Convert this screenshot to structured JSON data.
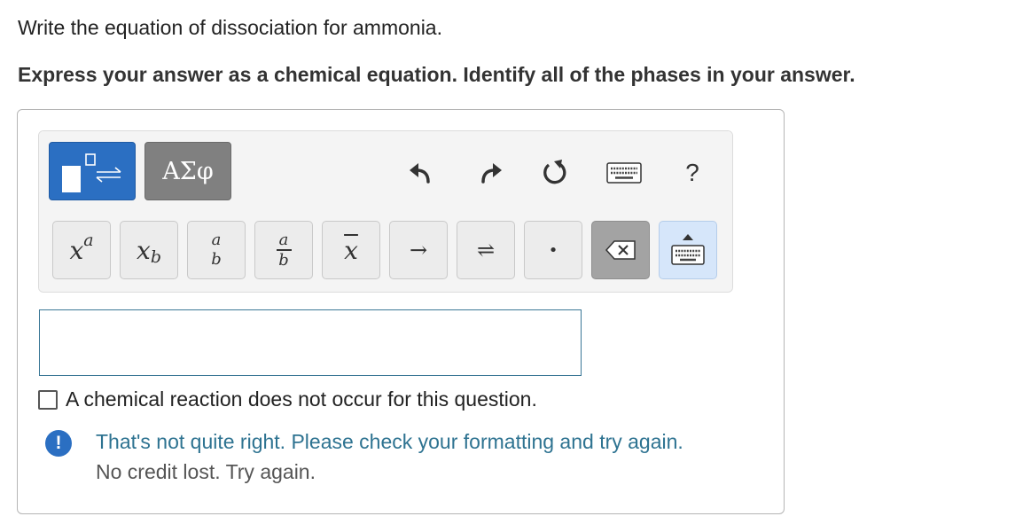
{
  "question": {
    "text": "Write the equation of dissociation for ammonia."
  },
  "instruction": {
    "text": "Express your answer as a chemical equation. Identify all of the phases in your answer."
  },
  "toolbar": {
    "templates_icon": "template-reaction-icon",
    "greek_label": "ΑΣφ",
    "undo_icon": "undo-icon",
    "redo_icon": "redo-icon",
    "reset_icon": "reset-icon",
    "keyboard_icon": "keyboard-icon",
    "help_label": "?"
  },
  "keys": [
    {
      "name": "superscript-key",
      "base": "x",
      "sup": "a"
    },
    {
      "name": "subscript-key",
      "base": "x",
      "sub": "b"
    },
    {
      "name": "fraction-key",
      "top": "a",
      "bottom": "b"
    },
    {
      "name": "fraction-bar-key",
      "top": "a",
      "bottom": "b"
    },
    {
      "name": "overbar-key",
      "label": "x"
    },
    {
      "name": "reaction-arrow-key",
      "label": "→"
    },
    {
      "name": "equilibrium-arrow-key",
      "label": "⇌"
    },
    {
      "name": "dot-key",
      "label": "•"
    },
    {
      "name": "backspace-key",
      "icon": "backspace-icon"
    },
    {
      "name": "toggle-keyboard-key",
      "icon": "keyboard-toggle-icon"
    }
  ],
  "answer_input": {
    "value": ""
  },
  "no_reaction": {
    "checked": false,
    "label": "A chemical reaction does not occur for this question."
  },
  "feedback": {
    "icon_label": "!",
    "message": "That's not quite right. Please check your formatting and try again.",
    "sub_message": "No credit lost. Try again."
  },
  "colors": {
    "accent_blue": "#2b6fc2",
    "feedback_text": "#2e7391",
    "greek_button": "#808080",
    "keypad_toggle": "#d6e6fa"
  }
}
